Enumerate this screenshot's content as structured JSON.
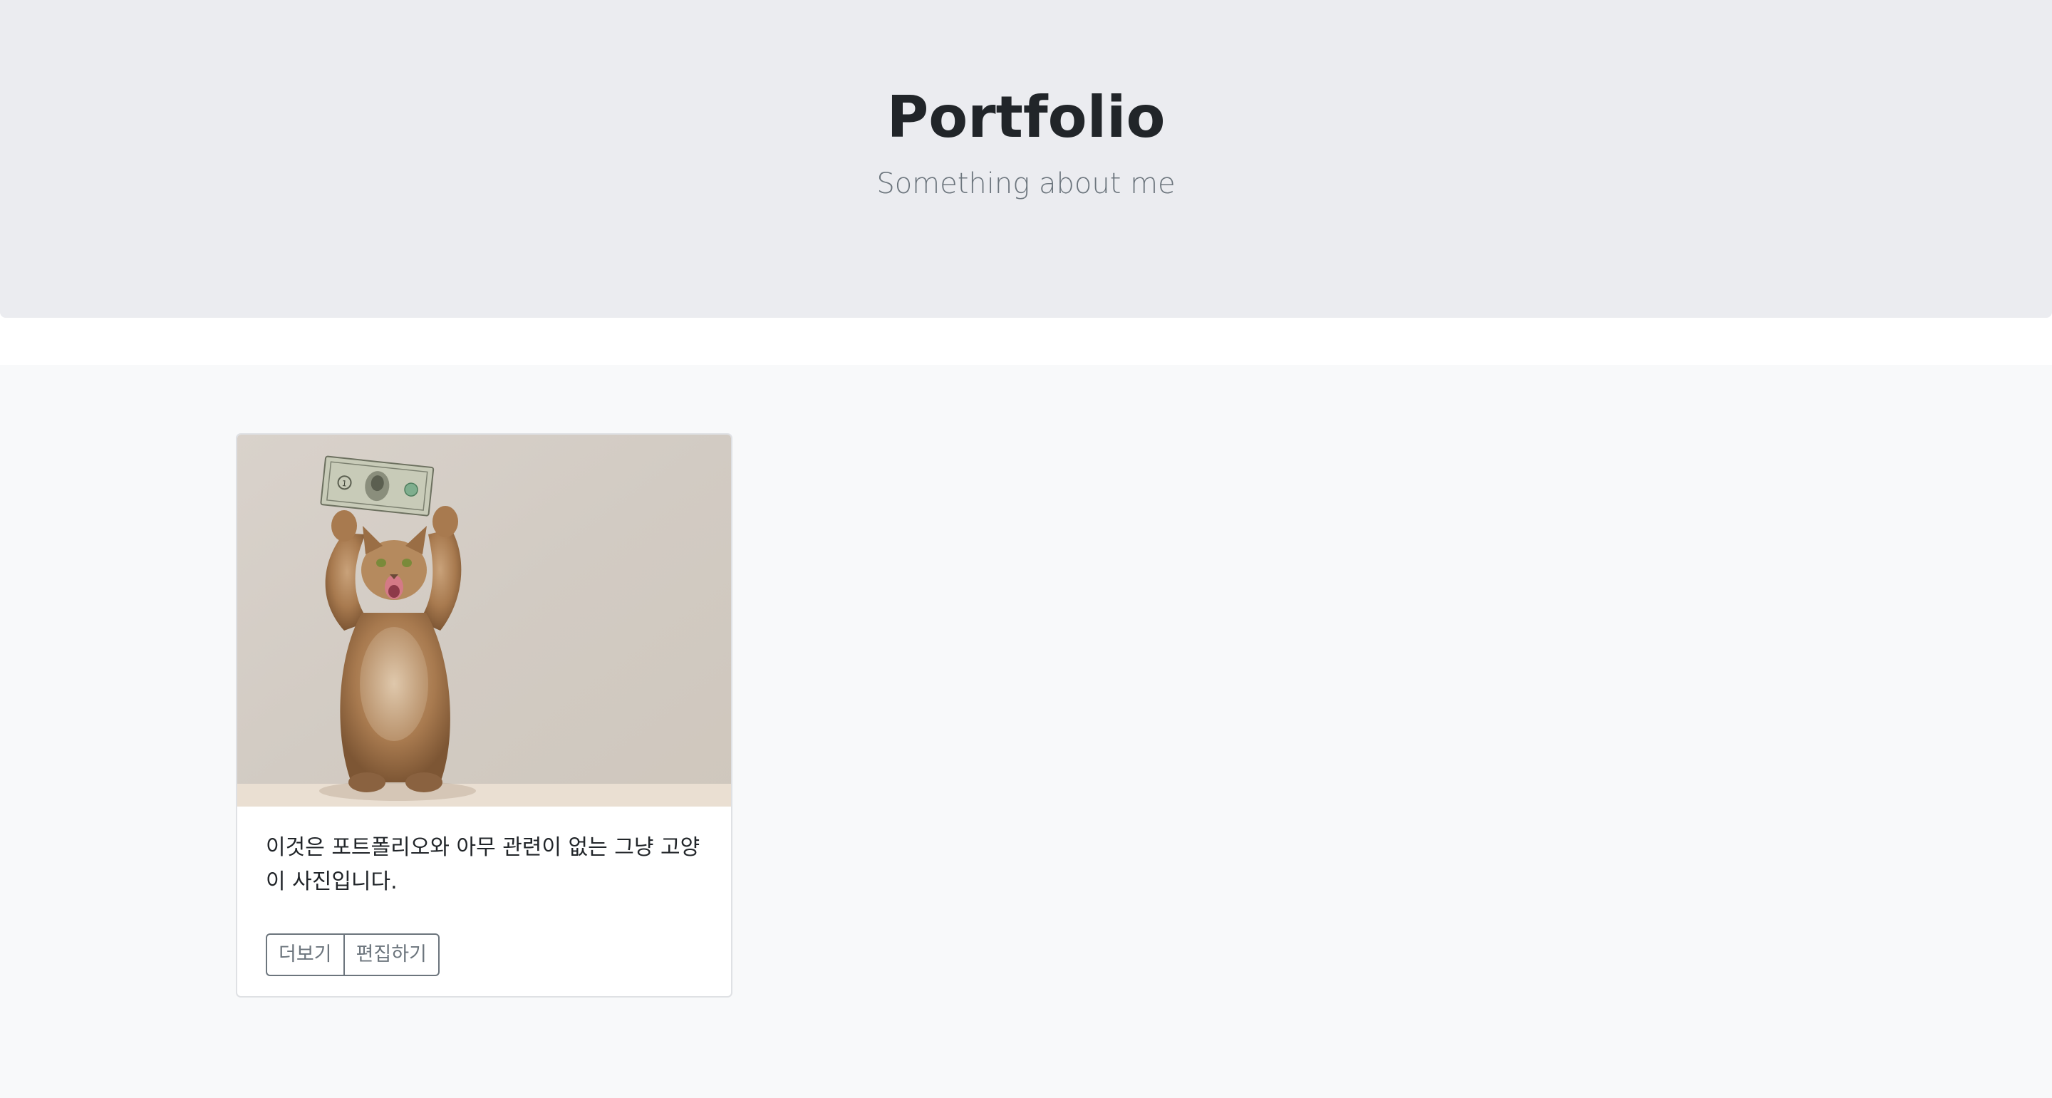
{
  "header": {
    "title": "Portfolio",
    "subtitle": "Something about me"
  },
  "card": {
    "image_alt": "cat holding a dollar bill",
    "text": "이것은 포트폴리오와 아무 관련이 없는 그냥 고양이 사진입니다.",
    "buttons": {
      "view_label": "더보기",
      "edit_label": "편집하기"
    }
  },
  "colors": {
    "jumbotron_bg": "#ebecf0",
    "album_bg": "#f8f9fa",
    "title": "#212529",
    "muted": "#6c757d"
  }
}
